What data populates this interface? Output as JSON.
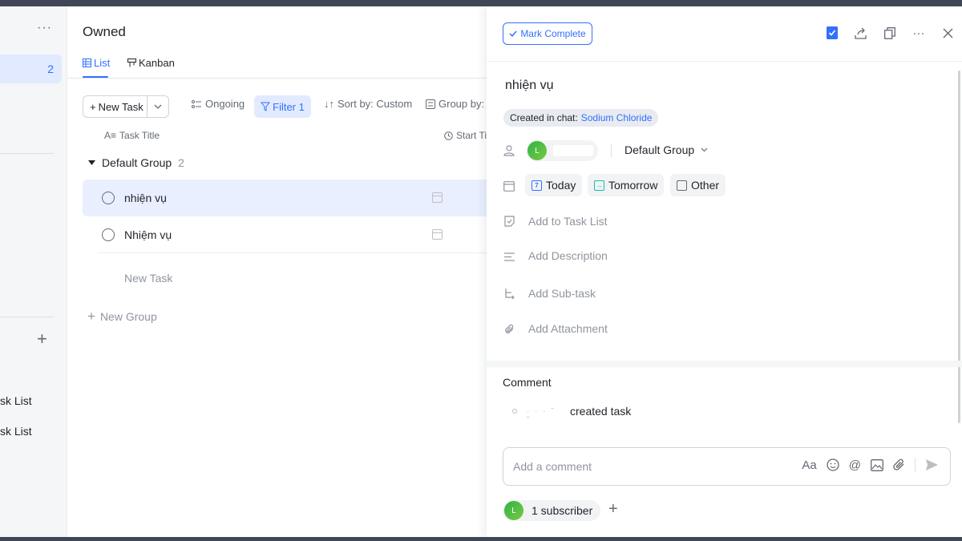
{
  "sidebar": {
    "more_icon": "···",
    "active_count": "2",
    "add_icon": "+",
    "items": [
      "sk List",
      "sk List"
    ]
  },
  "main": {
    "title": "Owned",
    "tabs": [
      {
        "label": "List",
        "icon": "list-icon"
      },
      {
        "label": "Kanban",
        "icon": "kanban-icon"
      }
    ],
    "toolbar": {
      "new_task": "New Task",
      "ongoing": "Ongoing",
      "filter": "Filter 1",
      "sort": "Sort by: Custom",
      "group": "Group by: C"
    },
    "columns": {
      "title": "Task Title",
      "start": "Start Ti"
    },
    "group": {
      "name": "Default Group",
      "count": "2"
    },
    "tasks": [
      {
        "title": "nhiện vụ",
        "selected": true
      },
      {
        "title": "Nhiệm vụ",
        "selected": false
      }
    ],
    "new_task_row": "New Task",
    "new_group": "New Group"
  },
  "detail": {
    "mark_complete": "Mark Complete",
    "task_title": "nhiện vụ",
    "created_in_chat_label": "Created in chat:",
    "chat_name": "Sodium Chloride",
    "assignee_initial": "L",
    "group_select": "Default Group",
    "due_chips": {
      "today": "Today",
      "tomorrow": "Tomorrow",
      "other": "Other",
      "today_day": "7"
    },
    "actions": {
      "task_list": "Add to Task List",
      "description": "Add Description",
      "subtask": "Add Sub-task",
      "attachment": "Add Attachment"
    },
    "comment_heading": "Comment",
    "activity": {
      "who": "· · ·  ˜ ˜",
      "what": "created task"
    },
    "comment_placeholder": "Add a comment",
    "subscribers": {
      "initial": "L",
      "label": "1 subscriber"
    },
    "colors": {
      "accent": "#3370ff",
      "selected_row": "#e9efff",
      "avatar": "#2fb344",
      "tomorrow": "#14c0a8"
    }
  }
}
